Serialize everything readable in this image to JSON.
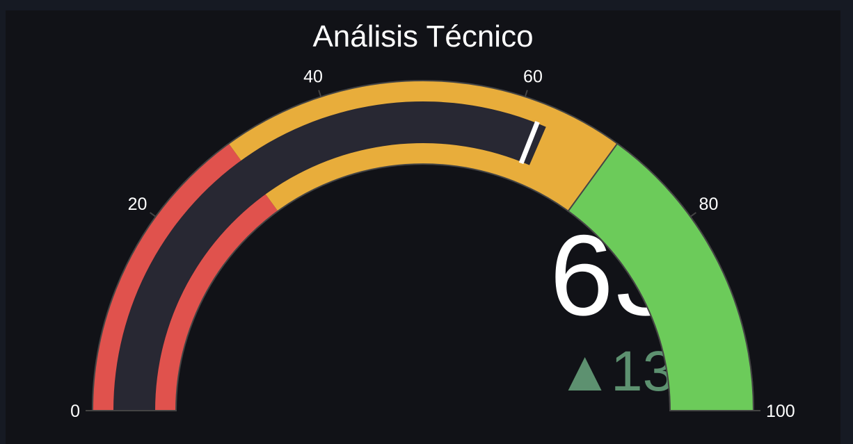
{
  "chart_data": {
    "type": "gauge",
    "title": "Análisis Técnico",
    "value": 63,
    "delta": 13,
    "delta_symbol": "▲",
    "axis": {
      "range": [
        0,
        100
      ],
      "ticks": [
        0,
        20,
        40,
        60,
        80,
        100
      ],
      "tick_labels": [
        "0",
        "20",
        "40",
        "60",
        "80",
        "100"
      ]
    },
    "steps": [
      {
        "range": [
          0,
          30
        ],
        "color": "#e0524d"
      },
      {
        "range": [
          30,
          70
        ],
        "color": "#e8ad3b"
      },
      {
        "range": [
          70,
          100
        ],
        "color": "#6ccb5a"
      }
    ],
    "bar_color": "#282833",
    "threshold": {
      "value": 62,
      "color": "#ffffff"
    },
    "colors": {
      "background": "#111217",
      "title": "#ffffff",
      "number": "#ffffff",
      "delta_increasing": "#5d9170",
      "tick_label": "#ffffff"
    }
  }
}
